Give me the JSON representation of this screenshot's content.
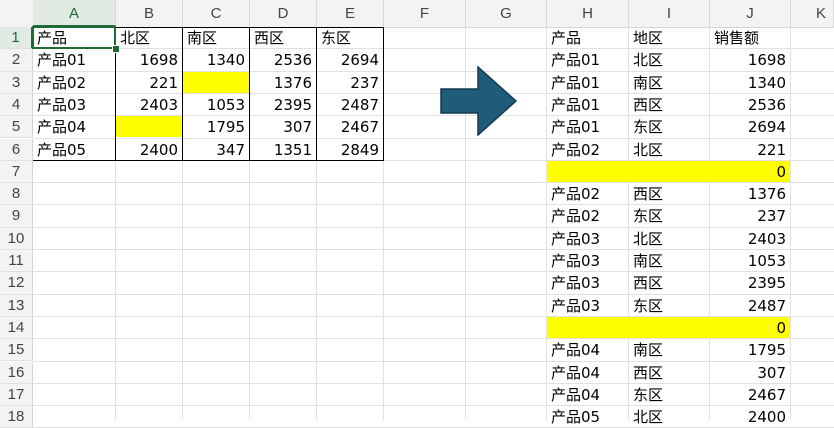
{
  "column_headers": [
    "A",
    "B",
    "C",
    "D",
    "E",
    "F",
    "G",
    "H",
    "I",
    "J",
    "K"
  ],
  "row_headers": [
    "1",
    "2",
    "3",
    "4",
    "5",
    "6",
    "7",
    "8",
    "9",
    "10",
    "11",
    "12",
    "13",
    "14",
    "15",
    "16",
    "17",
    "18"
  ],
  "left_table": {
    "header": [
      "产品",
      "北区",
      "南区",
      "西区",
      "东区"
    ],
    "rows": [
      [
        "产品01",
        "1698",
        "1340",
        "2536",
        "2694"
      ],
      [
        "产品02",
        "221",
        "",
        "1376",
        "237"
      ],
      [
        "产品03",
        "2403",
        "1053",
        "2395",
        "2487"
      ],
      [
        "产品04",
        "",
        "1795",
        "307",
        "2467"
      ],
      [
        "产品05",
        "2400",
        "347",
        "1351",
        "2849"
      ]
    ]
  },
  "right_table": {
    "header": [
      "产品",
      "地区",
      "销售额"
    ],
    "rows": [
      [
        "产品01",
        "北区",
        "1698"
      ],
      [
        "产品01",
        "南区",
        "1340"
      ],
      [
        "产品01",
        "西区",
        "2536"
      ],
      [
        "产品01",
        "东区",
        "2694"
      ],
      [
        "产品02",
        "北区",
        "221"
      ],
      [
        "",
        "",
        "0"
      ],
      [
        "产品02",
        "西区",
        "1376"
      ],
      [
        "产品02",
        "东区",
        "237"
      ],
      [
        "产品03",
        "北区",
        "2403"
      ],
      [
        "产品03",
        "南区",
        "1053"
      ],
      [
        "产品03",
        "西区",
        "2395"
      ],
      [
        "产品03",
        "东区",
        "2487"
      ],
      [
        "",
        "",
        "0"
      ],
      [
        "产品04",
        "南区",
        "1795"
      ],
      [
        "产品04",
        "西区",
        "307"
      ],
      [
        "产品04",
        "东区",
        "2467"
      ],
      [
        "产品05",
        "北区",
        "2400"
      ]
    ]
  },
  "colors": {
    "highlight": "#ffff00",
    "selection": "#1e6b35",
    "arrow_fill": "#1f5c7a",
    "arrow_stroke": "#123a4e"
  },
  "arrow_icon": "right-arrow-icon"
}
